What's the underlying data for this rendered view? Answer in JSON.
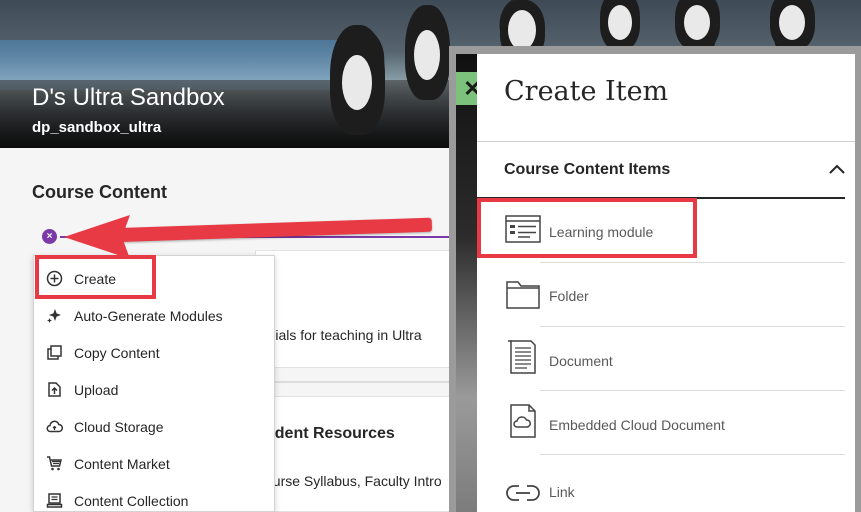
{
  "course": {
    "title": "D's Ultra Sandbox",
    "id": "dp_sandbox_ultra"
  },
  "main": {
    "section_title": "Course Content",
    "add_button": "×",
    "card1_text": "terials for teaching in Ultra",
    "card2_title": "udent Resources",
    "card2_text": "ourse Syllabus, Faculty Intro"
  },
  "menu": {
    "items": [
      {
        "label": "Create",
        "icon": "plus-circle-icon"
      },
      {
        "label": "Auto-Generate Modules",
        "icon": "sparkle-icon"
      },
      {
        "label": "Copy Content",
        "icon": "copy-icon"
      },
      {
        "label": "Upload",
        "icon": "upload-icon"
      },
      {
        "label": "Cloud Storage",
        "icon": "cloud-storage-icon"
      },
      {
        "label": "Content Market",
        "icon": "market-icon"
      },
      {
        "label": "Content Collection",
        "icon": "collection-icon"
      }
    ]
  },
  "panel": {
    "close": "✕",
    "title": "Create Item",
    "section": "Course Content Items",
    "items": [
      {
        "label": "Learning module",
        "icon": "learning-module-icon"
      },
      {
        "label": "Folder",
        "icon": "folder-icon"
      },
      {
        "label": "Document",
        "icon": "document-icon"
      },
      {
        "label": "Embedded Cloud Document",
        "icon": "cloud-document-icon"
      },
      {
        "label": "Link",
        "icon": "link-icon"
      }
    ]
  },
  "colors": {
    "callout": "#e83a45",
    "accent": "#7b3aa8",
    "close_button": "#7cc27c"
  }
}
